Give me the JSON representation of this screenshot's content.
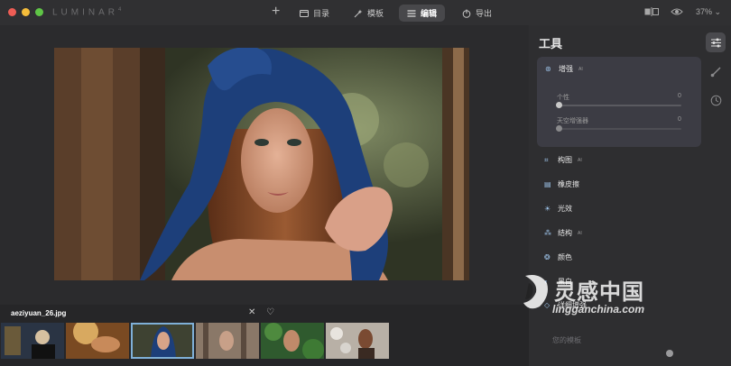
{
  "app": {
    "name": "LUMINAR",
    "version": "4"
  },
  "toolbar": {
    "plus": "+",
    "tabs": [
      {
        "label": "目录"
      },
      {
        "label": "模板"
      },
      {
        "label": "编辑"
      },
      {
        "label": "导出"
      }
    ],
    "zoom": "37%"
  },
  "filmstrip": {
    "filename": "aeziyuan_26.jpg",
    "close_glyph": "✕",
    "heart_glyph": "♡"
  },
  "panel": {
    "title": "工具",
    "enhance": {
      "label": "增强",
      "sliders": [
        {
          "label": "个性",
          "value": "0"
        },
        {
          "label": "天空增强器",
          "value": "0"
        }
      ]
    },
    "tools": [
      {
        "label": "构图",
        "icon": "crop-icon"
      },
      {
        "label": "橡皮擦",
        "icon": "eraser-icon"
      },
      {
        "label": "光效",
        "icon": "sun-icon"
      },
      {
        "label": "结构",
        "icon": "structure-icon"
      },
      {
        "label": "颜色",
        "icon": "color-icon"
      },
      {
        "label": "黑白",
        "icon": "bw-icon"
      },
      {
        "label": "详细增强",
        "icon": "detail-icon"
      }
    ],
    "your_templates": "您的模板"
  },
  "watermark": {
    "brand": "灵感中国",
    "url": "lingganchina.com"
  },
  "colors": {
    "accent": "#7fb0d8",
    "active_tab": "#48484b",
    "enhance_card": "#3c3c44"
  }
}
